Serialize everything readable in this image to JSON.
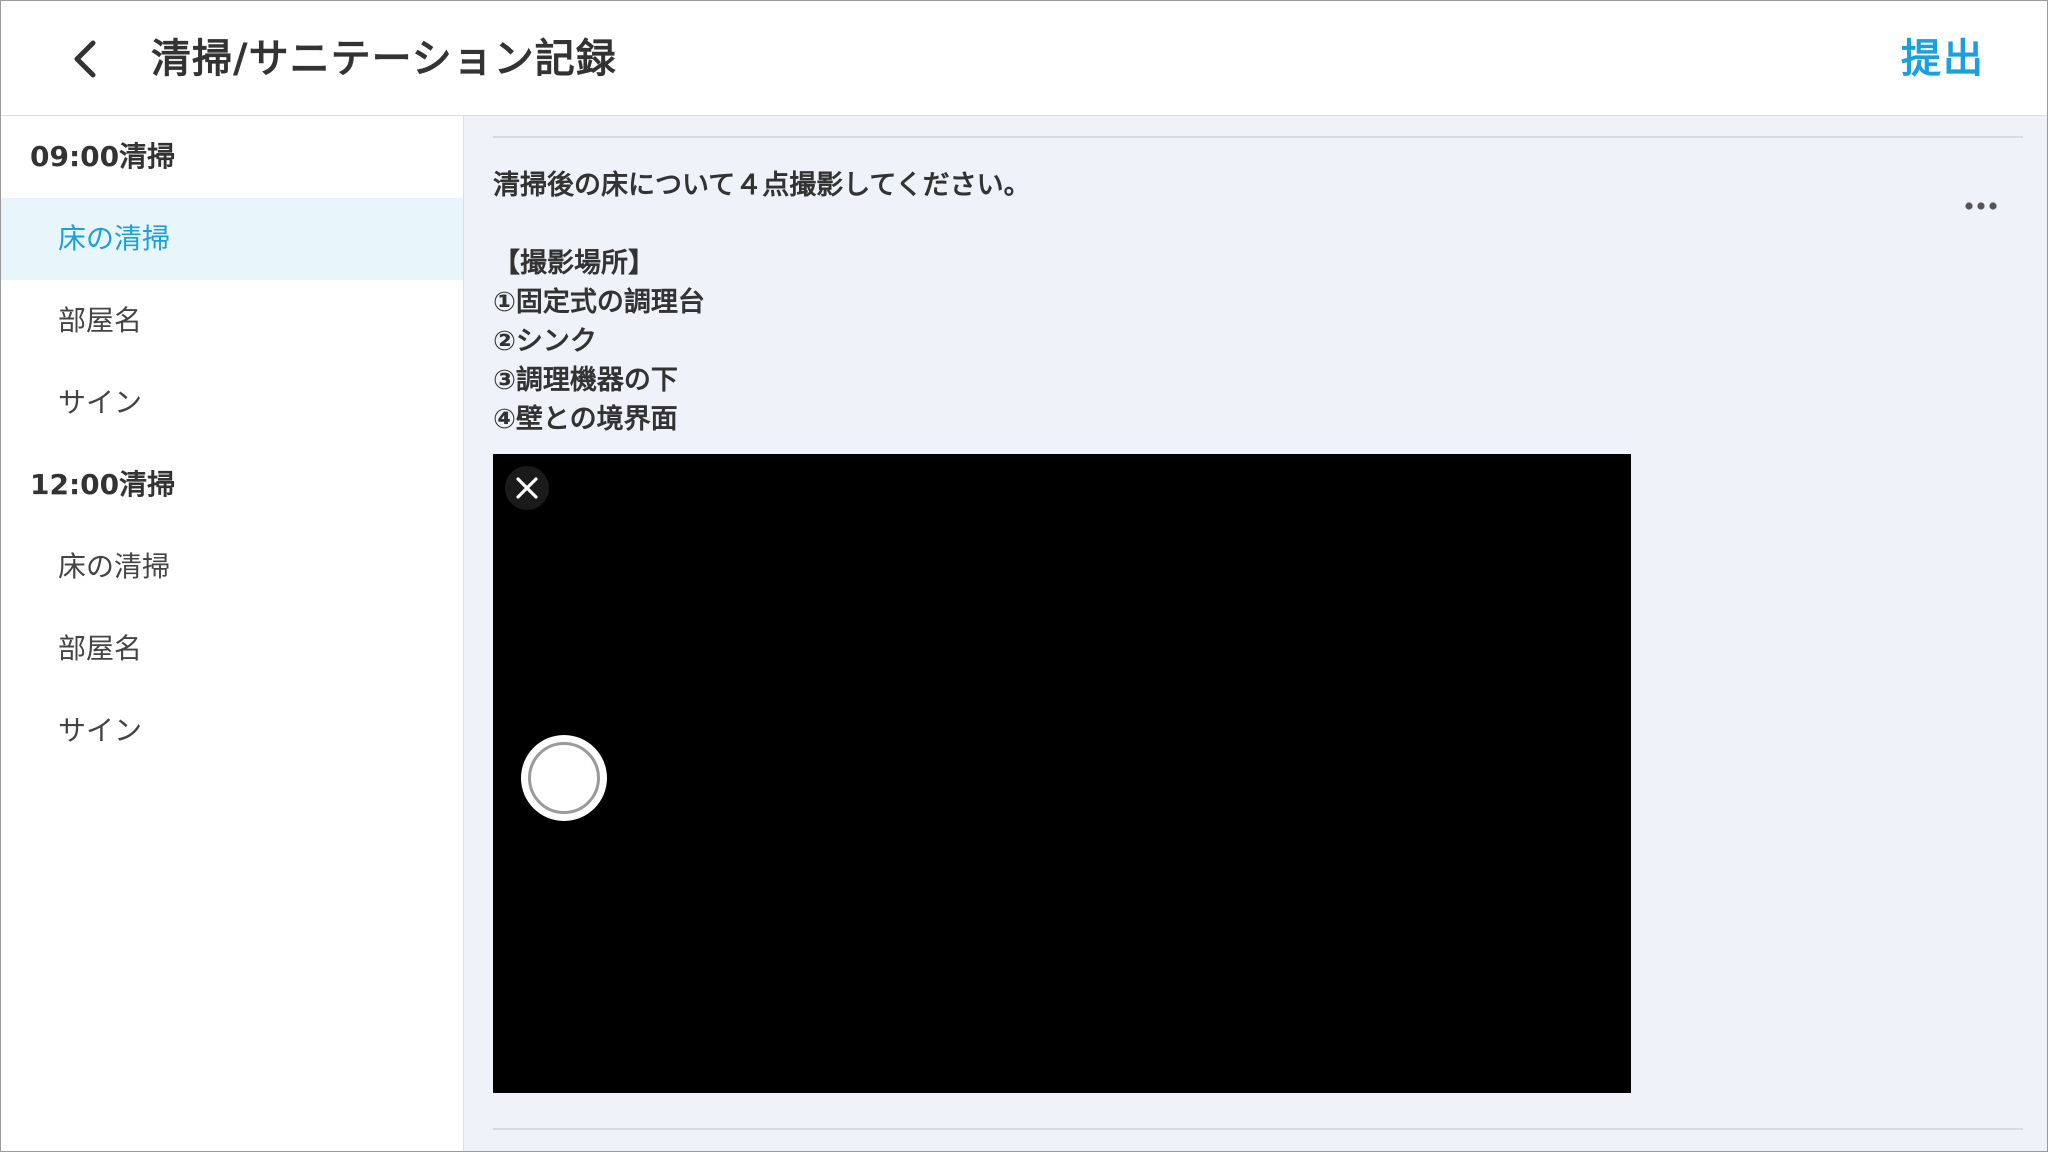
{
  "header": {
    "title": "清掃/サニテーション記録",
    "submit_label": "提出",
    "back_icon": "chevron-left-icon"
  },
  "sidebar": {
    "sections": [
      {
        "title": "09:00清掃",
        "items": [
          {
            "label": "床の清掃",
            "active": true
          },
          {
            "label": "部屋名",
            "active": false
          },
          {
            "label": "サイン",
            "active": false
          }
        ]
      },
      {
        "title": "12:00清掃",
        "items": [
          {
            "label": "床の清掃",
            "active": false
          },
          {
            "label": "部屋名",
            "active": false
          },
          {
            "label": "サイン",
            "active": false
          }
        ]
      }
    ]
  },
  "main": {
    "instruction": "清掃後の床について４点撮影してください。",
    "locations_header": "【撮影場所】",
    "locations": [
      "①固定式の調理台",
      "②シンク",
      "③調理機器の下",
      "④壁との境界面"
    ],
    "more_icon": "more-horizontal-icon",
    "camera": {
      "close_icon": "close-icon",
      "shutter_icon": "shutter-icon"
    }
  },
  "colors": {
    "accent": "#1aa0dc",
    "active_bg": "#e8f6fc",
    "main_bg": "#eff2f8",
    "status_dot": "#2ecc40"
  }
}
